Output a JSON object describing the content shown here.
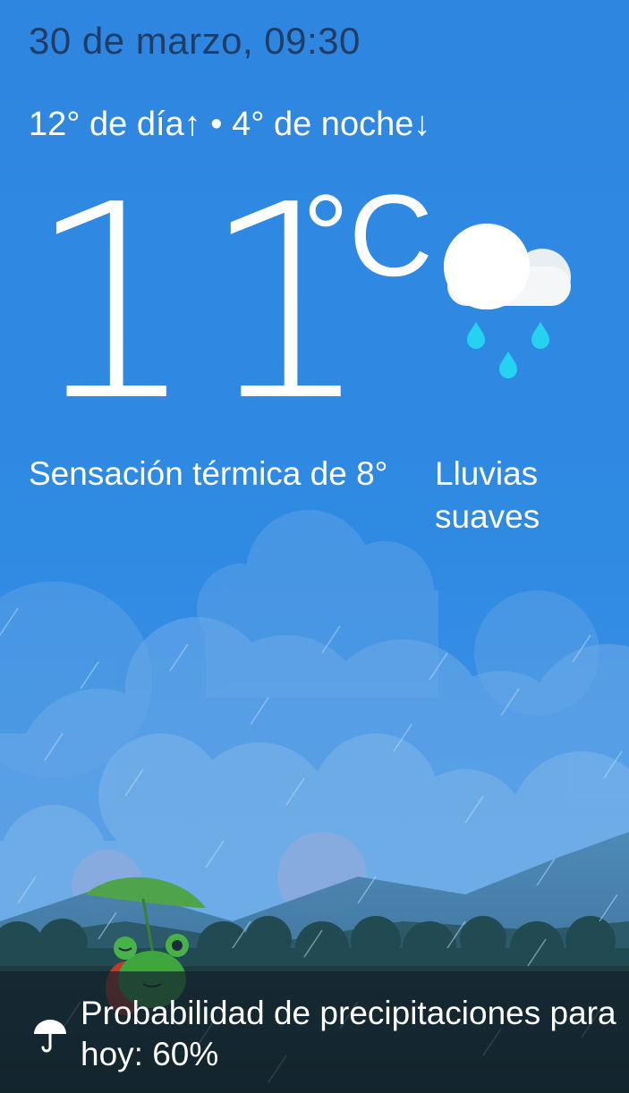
{
  "header": {
    "date_time": "30 de marzo, 09:30",
    "high_low": "12° de día↑ • 4° de noche↓"
  },
  "current": {
    "temperature": "11",
    "unit": "°C",
    "feels_like": "Sensación térmica de 8°",
    "condition": "Lluvias suaves",
    "condition_icon": "rain-cloud-icon"
  },
  "footer": {
    "icon": "umbrella-icon",
    "precipitation_text": "Probabilidad de precipitaciones para hoy: 60%"
  },
  "colors": {
    "sky": "#2f86e0",
    "date_text": "#1f3d66",
    "rain_drop": "#25d2f0",
    "footer_bg": "#142330"
  }
}
